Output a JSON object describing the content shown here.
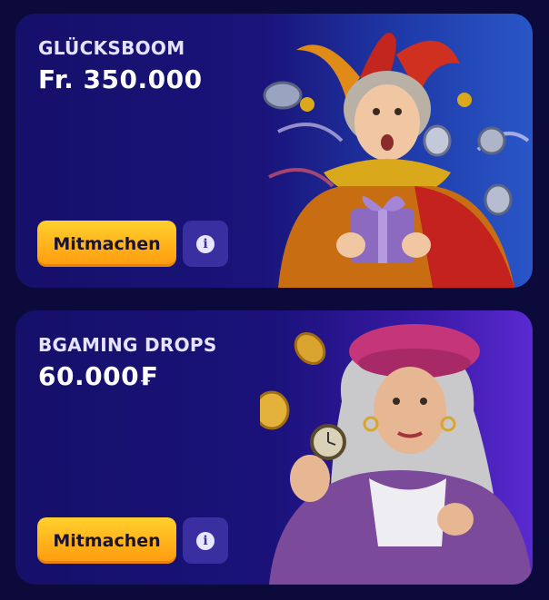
{
  "promotions": [
    {
      "label": "GLÜCKSBOOM",
      "amount": "Fr. 350.000",
      "join_label": "Mitmachen",
      "info_icon": "i",
      "art": "jester-woman-with-gift-and-coins"
    },
    {
      "label": "BGAMING DROPS",
      "amount": "60.000₣",
      "join_label": "Mitmachen",
      "info_icon": "i",
      "art": "elderly-woman-with-beret-and-pocket-watch"
    }
  ],
  "colors": {
    "page_background": "#0b0a3a",
    "card_background": "#1a137a",
    "button_yellow": "#ffc21f",
    "info_button": "#3a2fa0"
  }
}
